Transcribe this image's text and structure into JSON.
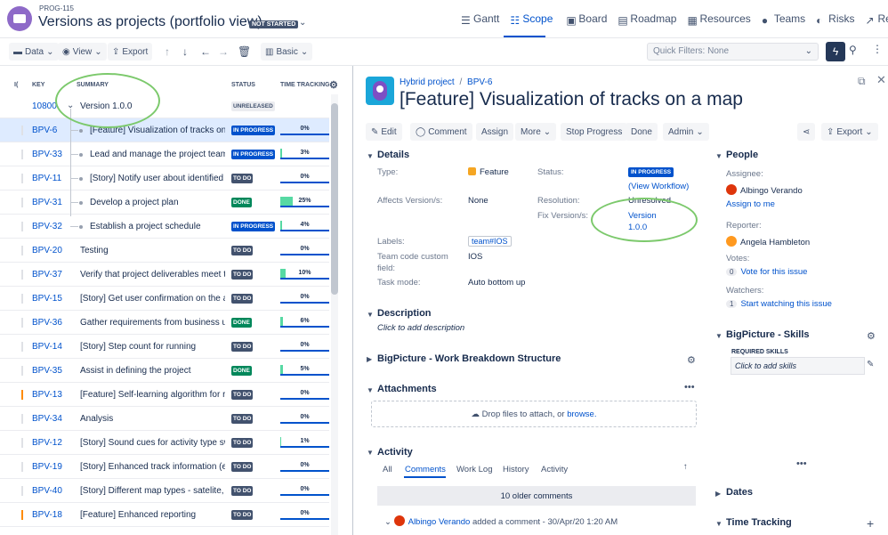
{
  "header": {
    "project_key": "PROG-115",
    "title": "Versions as projects (portfolio view)",
    "status_badge": "NOT STARTED",
    "nav": [
      {
        "label": "Gantt",
        "icon": "gantt-icon"
      },
      {
        "label": "Scope",
        "icon": "scope-icon",
        "active": true
      },
      {
        "label": "Board",
        "icon": "board-icon"
      },
      {
        "label": "Roadmap",
        "icon": "roadmap-icon"
      },
      {
        "label": "Resources",
        "icon": "resources-icon"
      },
      {
        "label": "Teams",
        "icon": "teams-icon"
      },
      {
        "label": "Risks",
        "icon": "risks-icon"
      },
      {
        "label": "Reports",
        "icon": "reports-icon"
      }
    ]
  },
  "toolbar": {
    "data": "Data",
    "view": "View",
    "export": "Export",
    "basic": "Basic",
    "quick_filters": "Quick Filters: None"
  },
  "table": {
    "columns": {
      "i": "I(",
      "key": "KEY",
      "summary": "SUMMARY",
      "status": "STATUS",
      "time": "TIME TRACKING"
    },
    "version_row": {
      "key": "10800",
      "summary": "Version 1.0.0",
      "status": "UNRELEASED"
    },
    "rows": [
      {
        "key": "BPV-6",
        "summary": "[Feature] Visualization of tracks on a map",
        "status": "IN PROGRESS",
        "progress": 0,
        "pct": "0%",
        "child": true,
        "selected": true
      },
      {
        "key": "BPV-33",
        "summary": "Lead and manage the project team",
        "status": "IN PROGRESS",
        "progress": 3,
        "pct": "3%",
        "child": true
      },
      {
        "key": "BPV-11",
        "summary": "[Story] Notify user about identified activity",
        "status": "TO DO",
        "progress": 0,
        "pct": "0%",
        "child": true
      },
      {
        "key": "BPV-31",
        "summary": "Develop a project plan",
        "status": "DONE",
        "progress": 25,
        "pct": "25%",
        "child": true
      },
      {
        "key": "BPV-32",
        "summary": "Establish a project schedule",
        "status": "IN PROGRESS",
        "progress": 4,
        "pct": "4%",
        "child": true
      },
      {
        "key": "BPV-20",
        "summary": "Testing",
        "status": "TO DO",
        "progress": 0,
        "pct": "0%"
      },
      {
        "key": "BPV-37",
        "summary": "Verify that project deliverables meet the requirements",
        "status": "TO DO",
        "progress": 10,
        "pct": "10%"
      },
      {
        "key": "BPV-15",
        "summary": "[Story] Get user confirmation on the activity",
        "status": "TO DO",
        "progress": 0,
        "pct": "0%"
      },
      {
        "key": "BPV-36",
        "summary": "Gather requirements from business units",
        "status": "DONE",
        "progress": 6,
        "pct": "6%"
      },
      {
        "key": "BPV-14",
        "summary": "[Story] Step count for running",
        "status": "TO DO",
        "progress": 0,
        "pct": "0%"
      },
      {
        "key": "BPV-35",
        "summary": "Assist in defining the project",
        "status": "DONE",
        "progress": 5,
        "pct": "5%"
      },
      {
        "key": "BPV-13",
        "summary": "[Feature] Self-learning algorithm for running",
        "status": "TO DO",
        "progress": 0,
        "pct": "0%",
        "orange": true
      },
      {
        "key": "BPV-34",
        "summary": "Analysis",
        "status": "TO DO",
        "progress": 0,
        "pct": "0%"
      },
      {
        "key": "BPV-12",
        "summary": "[Story] Sound cues for activity type switching",
        "status": "TO DO",
        "progress": 1,
        "pct": "1%"
      },
      {
        "key": "BPV-19",
        "summary": "[Story] Enhanced track information (elevation)",
        "status": "TO DO",
        "progress": 0,
        "pct": "0%"
      },
      {
        "key": "BPV-40",
        "summary": "[Story] Different map types - satelite, normal",
        "status": "TO DO",
        "progress": 0,
        "pct": "0%"
      },
      {
        "key": "BPV-18",
        "summary": "[Feature] Enhanced reporting",
        "status": "TO DO",
        "progress": 0,
        "pct": "0%",
        "orange": true
      }
    ]
  },
  "issue": {
    "crumb_project": "Hybrid project",
    "crumb_sep": "/",
    "crumb_key": "BPV-6",
    "title": "[Feature] Visualization of tracks on a map",
    "actions": {
      "edit": "Edit",
      "comment": "Comment",
      "assign": "Assign",
      "more": "More",
      "stop": "Stop Progress",
      "done": "Done",
      "admin": "Admin",
      "export": "Export"
    },
    "details": {
      "heading": "Details",
      "type_label": "Type:",
      "type_value": "Feature",
      "status_label": "Status:",
      "status_value": "IN PROGRESS",
      "view_workflow": "(View Workflow)",
      "affects_label": "Affects Version/s:",
      "affects_value": "None",
      "resolution_label": "Resolution:",
      "resolution_value": "Unresolved",
      "fix_label": "Fix Version/s:",
      "fix_value_1": "Version",
      "fix_value_2": "1.0.0",
      "labels_label": "Labels:",
      "labels_value": "team#IOS",
      "team_code_label_1": "Team code custom",
      "team_code_label_2": "field:",
      "team_code_value": "IOS",
      "task_mode_label": "Task mode:",
      "task_mode_value": "Auto bottom up"
    },
    "description": {
      "heading": "Description",
      "placeholder": "Click to add description"
    },
    "wbs_heading": "BigPicture - Work Breakdown Structure",
    "attachments": {
      "heading": "Attachments",
      "drop_text": "Drop files to attach, or ",
      "browse": "browse."
    },
    "activity": {
      "heading": "Activity",
      "tabs": [
        "All",
        "Comments",
        "Work Log",
        "History",
        "Activity"
      ],
      "older": "10 older comments",
      "comment_author": "Albingo Verando",
      "comment_text": " added a comment - 30/Apr/20 1:20 AM"
    }
  },
  "people": {
    "heading": "People",
    "assignee_label": "Assignee:",
    "assignee": "Albingo Verando",
    "assign_me": "Assign to me",
    "reporter_label": "Reporter:",
    "reporter": "Angela Hambleton",
    "votes_label": "Votes:",
    "votes_count": "0",
    "vote_link": "Vote for this issue",
    "watchers_label": "Watchers:",
    "watchers_count": "1",
    "watch_link": "Start watching this issue"
  },
  "skills": {
    "heading": "BigPicture - Skills",
    "required": "REQUIRED SKILLS",
    "placeholder": "Click to add skills"
  },
  "dates_heading": "Dates",
  "time_tracking_heading": "Time Tracking",
  "colors": {
    "accent": "#0052cc",
    "todo": "#42526e",
    "done": "#00875a",
    "annotation": "#7cc96c"
  }
}
